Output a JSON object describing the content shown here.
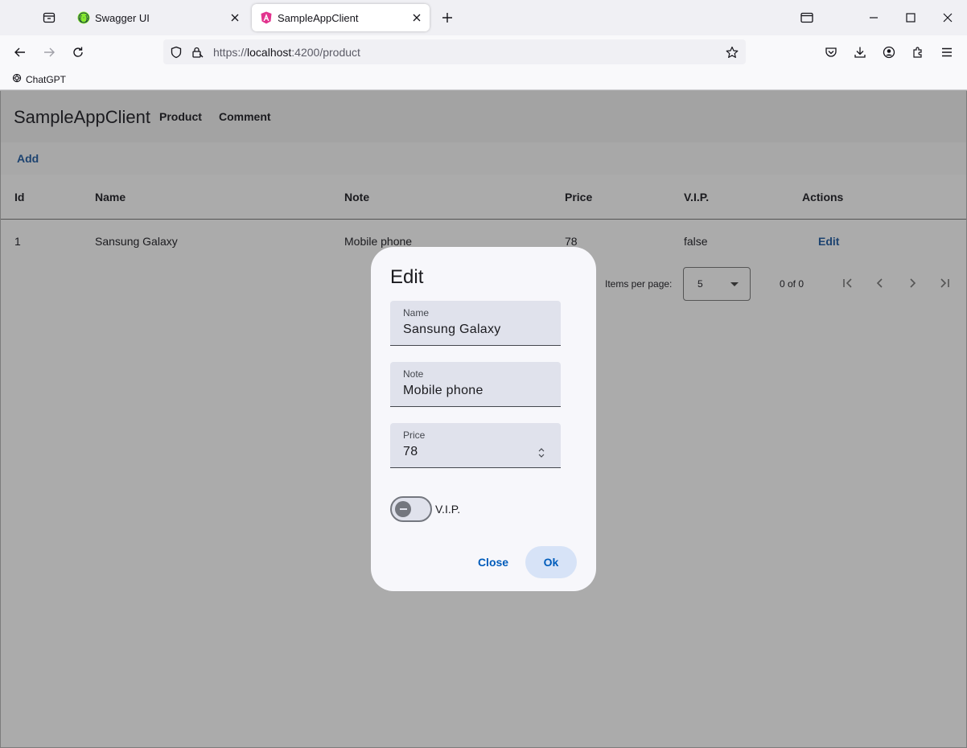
{
  "browser": {
    "tabs": [
      {
        "title": "Swagger UI",
        "icon": "swagger-icon"
      },
      {
        "title": "SampleAppClient",
        "icon": "angular-icon",
        "active": true
      }
    ],
    "url_scheme": "https://",
    "url_host": "localhost",
    "url_rest": ":4200/product",
    "bookmarks": [
      {
        "label": "ChatGPT",
        "icon": "openai-icon"
      }
    ]
  },
  "app": {
    "title": "SampleAppClient",
    "nav": [
      "Product",
      "Comment"
    ],
    "add_label": "Add"
  },
  "table": {
    "columns": [
      "Id",
      "Name",
      "Note",
      "Price",
      "V.I.P.",
      "Actions"
    ],
    "rows": [
      {
        "id": "1",
        "name": "Sansung Galaxy",
        "note": "Mobile phone",
        "price": "78",
        "vip": "false",
        "action": "Edit"
      }
    ]
  },
  "paginator": {
    "items_per_page_label": "Items per page:",
    "page_size": "5",
    "range": "0 of 0"
  },
  "dialog": {
    "title": "Edit",
    "fields": {
      "name": {
        "label": "Name",
        "value": "Sansung Galaxy"
      },
      "note": {
        "label": "Note",
        "value": "Mobile phone"
      },
      "price": {
        "label": "Price",
        "value": "78"
      }
    },
    "vip_label": "V.I.P.",
    "vip_checked": false,
    "close_label": "Close",
    "ok_label": "Ok"
  },
  "colors": {
    "primary": "#005cbb",
    "backdrop": "#ababab",
    "dialog_bg": "#f7f7fb",
    "field_bg": "#e0e2ec"
  }
}
